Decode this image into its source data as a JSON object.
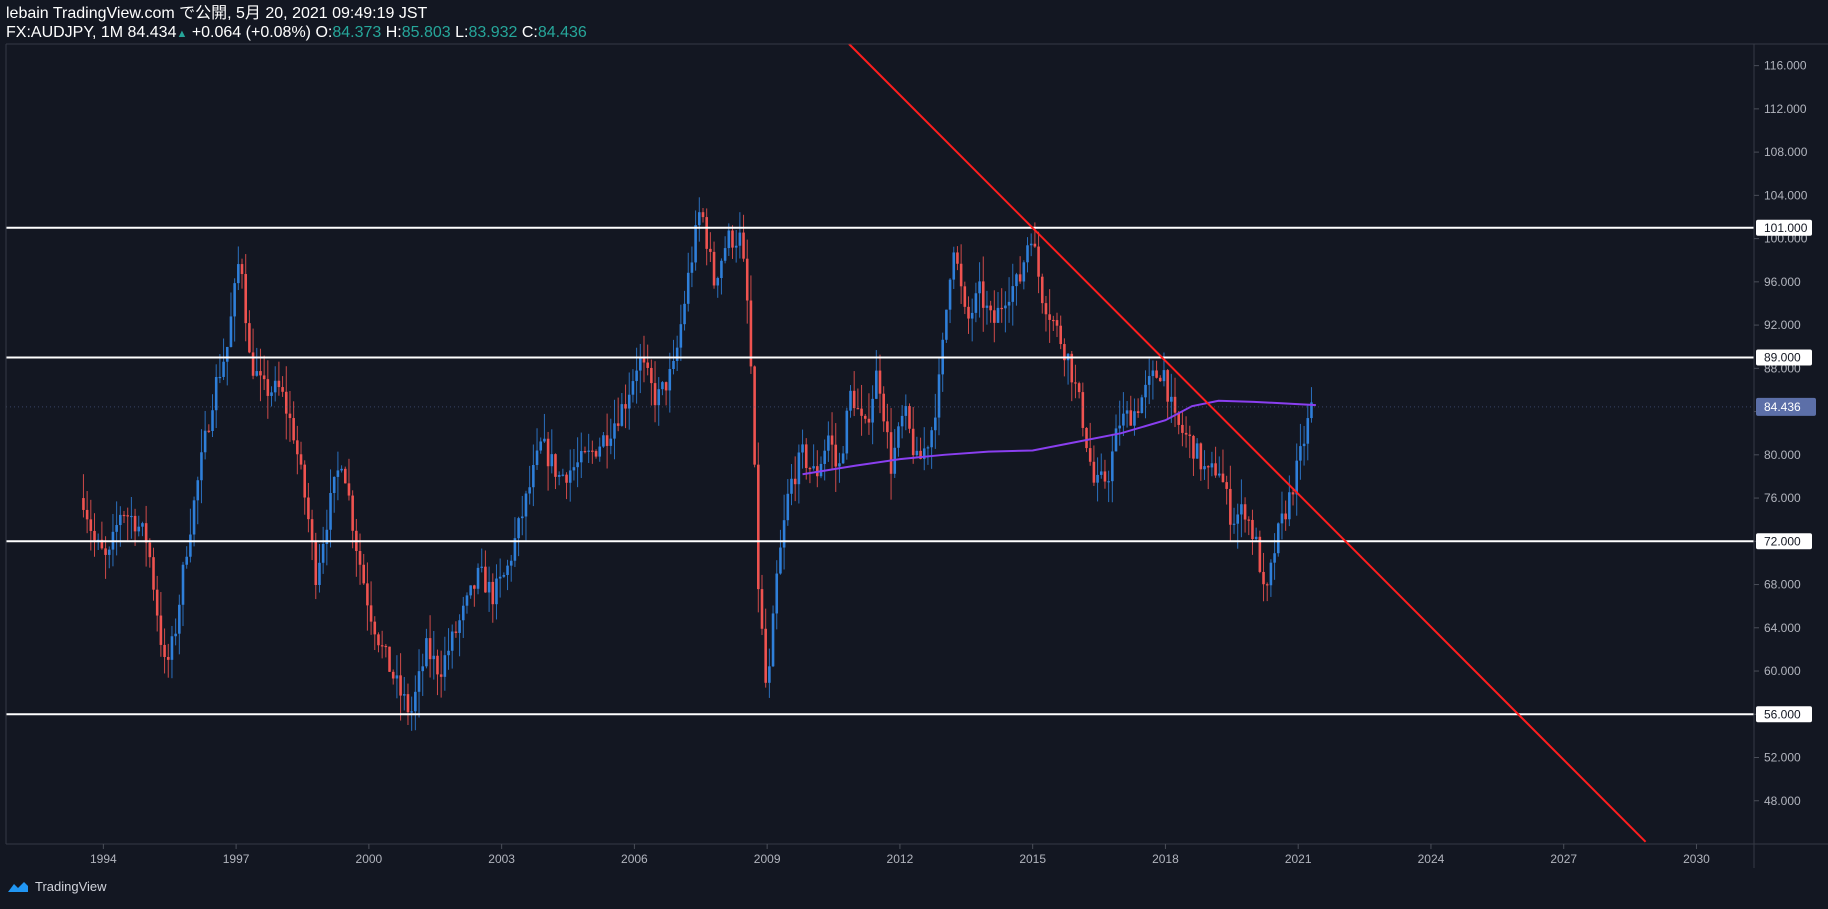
{
  "header": {
    "line1": "lebain TradingView.com で公開, 5月 20, 2021 09:49:19 JST",
    "symbol": "FX:AUDJPY, 1M",
    "last": "84.434",
    "change": "+0.064 (+0.08%)",
    "o_label": "O:",
    "o_value": "84.373",
    "h_label": "H:",
    "h_value": "85.803",
    "l_label": "L:",
    "l_value": "83.932",
    "c_label": "C:",
    "c_value": "84.436"
  },
  "footer": {
    "brand": "TradingView"
  },
  "colors": {
    "background": "#131722",
    "up": "#2f7fd9",
    "down": "#ef5350",
    "ma": "#8a3ff0",
    "trendline": "#ff1e1e",
    "level": "#ffffff",
    "price_tag": "#5c6fa8"
  },
  "chart_data": {
    "type": "candlestick",
    "symbol": "FX:AUDJPY",
    "timeframe": "1M",
    "price_axis": {
      "min": 44,
      "max": 118,
      "ticks": [
        "48.000",
        "52.000",
        "56.000",
        "60.000",
        "64.000",
        "68.000",
        "72.000",
        "76.000",
        "80.000",
        "84.000",
        "88.000",
        "92.000",
        "96.000",
        "100.000",
        "104.000",
        "108.000",
        "112.000",
        "116.000"
      ]
    },
    "time_axis": {
      "start": 1991.8,
      "end": 2031.3,
      "ticks": [
        "1994",
        "1997",
        "2000",
        "2003",
        "2006",
        "2009",
        "2012",
        "2015",
        "2018",
        "2021",
        "2024",
        "2027",
        "2030"
      ]
    },
    "horizontal_levels": [
      {
        "value": 101,
        "label": "101.000"
      },
      {
        "value": 89,
        "label": "89.000"
      },
      {
        "value": 72,
        "label": "72.000"
      },
      {
        "value": 56,
        "label": "56.000"
      }
    ],
    "current_price": {
      "value": 84.436,
      "label": "84.436"
    },
    "trendline": {
      "from": {
        "time": 2010.85,
        "price": 118
      },
      "to": {
        "time": 2028.85,
        "price": 44.2
      }
    },
    "moving_average": [
      [
        2009.8,
        78.2
      ],
      [
        2011,
        79.0
      ],
      [
        2012,
        79.6
      ],
      [
        2013,
        80.0
      ],
      [
        2014,
        80.3
      ],
      [
        2015,
        80.4
      ],
      [
        2016,
        81.2
      ],
      [
        2017,
        82.0
      ],
      [
        2018,
        83.2
      ],
      [
        2018.6,
        84.5
      ],
      [
        2019.2,
        85.0
      ],
      [
        2020,
        84.9
      ],
      [
        2021.4,
        84.6
      ]
    ],
    "price_path": [
      [
        1993.55,
        76
      ],
      [
        1993.8,
        72
      ],
      [
        1994.1,
        70
      ],
      [
        1994.4,
        75
      ],
      [
        1994.7,
        74
      ],
      [
        1995.0,
        72
      ],
      [
        1995.2,
        66
      ],
      [
        1995.4,
        60
      ],
      [
        1995.6,
        63
      ],
      [
        1995.9,
        72
      ],
      [
        1996.2,
        79
      ],
      [
        1996.5,
        86
      ],
      [
        1996.8,
        90
      ],
      [
        1997.1,
        99
      ],
      [
        1997.3,
        89
      ],
      [
        1997.6,
        86
      ],
      [
        1998.0,
        86
      ],
      [
        1998.3,
        82
      ],
      [
        1998.6,
        75
      ],
      [
        1998.8,
        69
      ],
      [
        1999.1,
        75
      ],
      [
        1999.4,
        80
      ],
      [
        1999.7,
        72
      ],
      [
        2000.0,
        66
      ],
      [
        2000.3,
        62
      ],
      [
        2000.7,
        58
      ],
      [
        2000.95,
        56
      ],
      [
        2001.3,
        62
      ],
      [
        2001.6,
        60
      ],
      [
        2001.9,
        63
      ],
      [
        2002.2,
        66
      ],
      [
        2002.5,
        69
      ],
      [
        2002.8,
        67
      ],
      [
        2003.1,
        69
      ],
      [
        2003.5,
        75
      ],
      [
        2003.9,
        81
      ],
      [
        2004.3,
        78
      ],
      [
        2004.7,
        79
      ],
      [
        2005.0,
        80
      ],
      [
        2005.4,
        82
      ],
      [
        2005.8,
        85
      ],
      [
        2006.1,
        89
      ],
      [
        2006.5,
        85
      ],
      [
        2006.9,
        88
      ],
      [
        2007.2,
        96
      ],
      [
        2007.5,
        103
      ],
      [
        2007.8,
        96
      ],
      [
        2008.1,
        100
      ],
      [
        2008.4,
        100
      ],
      [
        2008.6,
        92
      ],
      [
        2008.8,
        68
      ],
      [
        2009.0,
        57
      ],
      [
        2009.2,
        68
      ],
      [
        2009.5,
        77
      ],
      [
        2009.8,
        80
      ],
      [
        2010.1,
        78
      ],
      [
        2010.4,
        82
      ],
      [
        2010.6,
        78
      ],
      [
        2010.9,
        86
      ],
      [
        2011.2,
        82
      ],
      [
        2011.5,
        88
      ],
      [
        2011.8,
        79
      ],
      [
        2012.1,
        84
      ],
      [
        2012.4,
        79
      ],
      [
        2012.7,
        82
      ],
      [
        2012.9,
        87
      ],
      [
        2013.2,
        100
      ],
      [
        2013.5,
        92
      ],
      [
        2013.8,
        95
      ],
      [
        2014.1,
        92
      ],
      [
        2014.4,
        95
      ],
      [
        2014.7,
        96
      ],
      [
        2014.95,
        101
      ],
      [
        2015.2,
        95
      ],
      [
        2015.5,
        92
      ],
      [
        2015.8,
        89
      ],
      [
        2016.1,
        84
      ],
      [
        2016.4,
        77
      ],
      [
        2016.7,
        78
      ],
      [
        2016.95,
        83
      ],
      [
        2017.3,
        84
      ],
      [
        2017.7,
        87
      ],
      [
        2017.95,
        88
      ],
      [
        2018.2,
        83
      ],
      [
        2018.6,
        81
      ],
      [
        2018.95,
        78
      ],
      [
        2019.2,
        79
      ],
      [
        2019.5,
        74
      ],
      [
        2019.8,
        75
      ],
      [
        2020.1,
        71
      ],
      [
        2020.25,
        66
      ],
      [
        2020.5,
        72
      ],
      [
        2020.8,
        76
      ],
      [
        2021.0,
        79
      ],
      [
        2021.3,
        84.4
      ]
    ]
  }
}
